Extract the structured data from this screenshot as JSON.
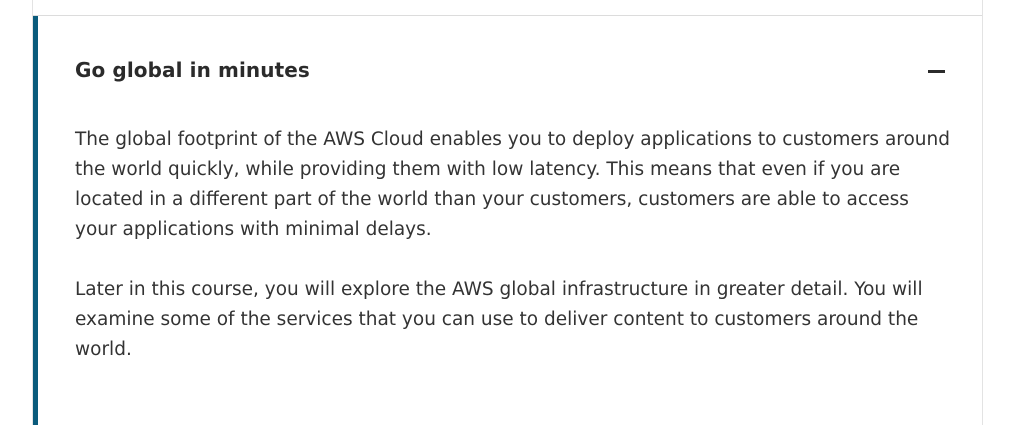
{
  "accordion": {
    "title": "Go global in minutes",
    "expanded": true,
    "toggle_icon": "minus-icon",
    "accent_color": "#0a5b7c",
    "paragraphs": [
      "The global footprint of the AWS Cloud enables you to deploy applications to customers around the world quickly, while providing them with low latency. This means that even if you are located in a different part of the world than your customers, customers are able to access your applications with minimal delays.",
      "Later in this course, you will explore the AWS global infrastructure in greater detail. You will examine some of the services that you can use to deliver content to customers around the world."
    ]
  }
}
